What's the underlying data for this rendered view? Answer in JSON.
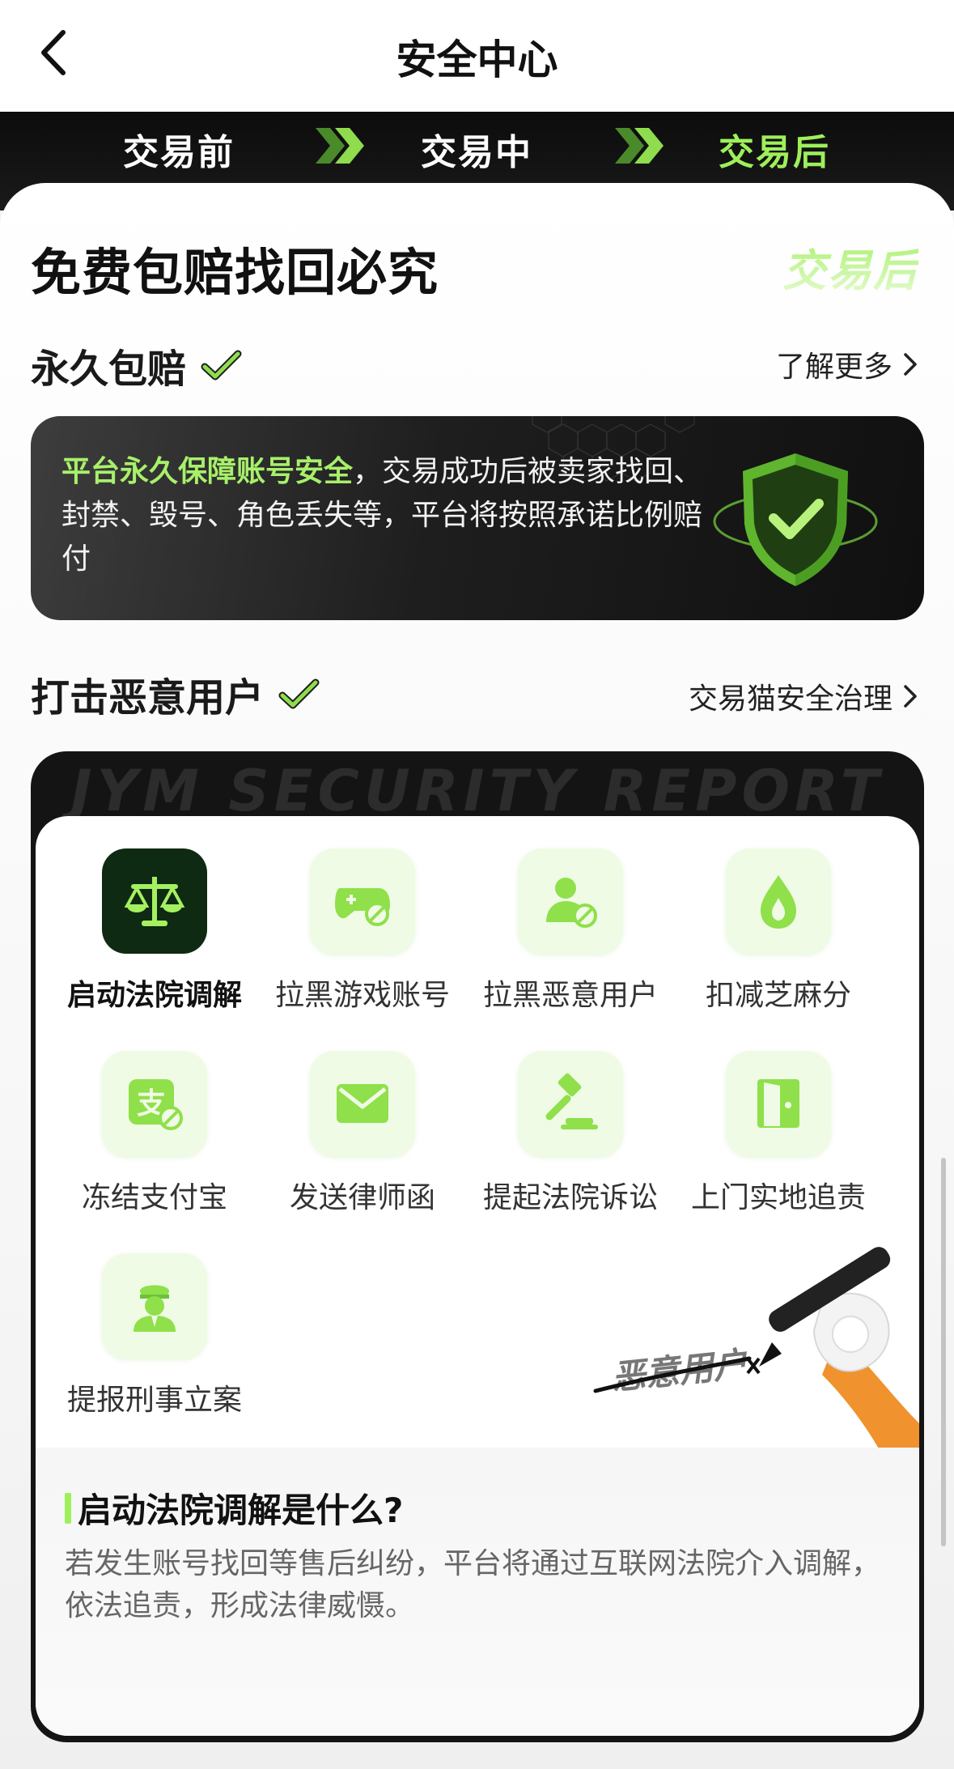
{
  "header": {
    "title": "安全中心"
  },
  "stages": {
    "items": [
      {
        "label": "交易前",
        "active": false
      },
      {
        "label": "交易中",
        "active": false
      },
      {
        "label": "交易后",
        "active": true
      }
    ]
  },
  "hero": {
    "title": "免费包赔找回必究",
    "badge": "交易后"
  },
  "compensation": {
    "title": "永久包赔",
    "link": "了解更多",
    "highlight": "平台永久保障账号安全",
    "text": "，交易成功后被卖家找回、封禁、毁号、角色丢失等，平台将按照承诺比例赔付"
  },
  "malicious": {
    "title": "打击恶意用户",
    "link": "交易猫安全治理",
    "watermark": "JYM   SECURITY   REPORT",
    "actions": [
      {
        "label": "启动法院调解",
        "icon": "scale-icon",
        "active": true
      },
      {
        "label": "拉黑游戏账号",
        "icon": "gamepad-block-icon",
        "active": false
      },
      {
        "label": "拉黑恶意用户",
        "icon": "user-block-icon",
        "active": false
      },
      {
        "label": "扣减芝麻分",
        "icon": "sesame-drop-icon",
        "active": false
      },
      {
        "label": "冻结支付宝",
        "icon": "alipay-freeze-icon",
        "active": false
      },
      {
        "label": "发送律师函",
        "icon": "envelope-icon",
        "active": false
      },
      {
        "label": "提起法院诉讼",
        "icon": "gavel-icon",
        "active": false
      },
      {
        "label": "上门实地追责",
        "icon": "door-icon",
        "active": false
      },
      {
        "label": "提报刑事立案",
        "icon": "police-icon",
        "active": false
      }
    ],
    "illustration_text": "恶意用户",
    "desc_title": "启动法院调解是什么?",
    "desc_text": "若发生账号找回等售后纠纷，平台将通过互联网法院介入调解，依法追责，形成法律威慑。"
  },
  "colors": {
    "accent": "#9ef05a",
    "dark": "#141414",
    "icon_bg": "#f0fbe6"
  }
}
